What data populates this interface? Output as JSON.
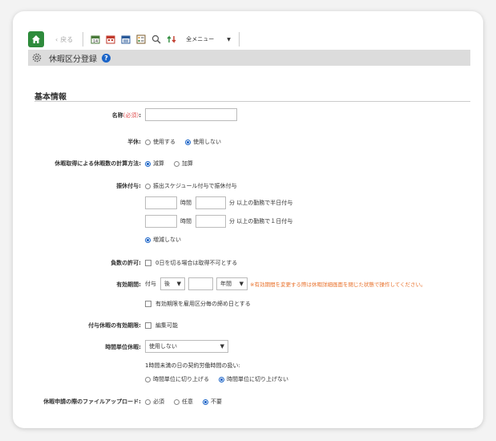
{
  "toolbar": {
    "back_label": "戻る",
    "menu_label": "全メニュー",
    "icons": [
      "calendar-14-icon",
      "calendar-red-icon",
      "calendar-list-icon",
      "card-list-icon",
      "magnify-icon",
      "sort-arrows-icon"
    ]
  },
  "title_bar": {
    "title": "休暇区分登録",
    "help": "?"
  },
  "section": {
    "title": "基本情報"
  },
  "form": {
    "name": {
      "label": "名称",
      "required": "(必須)",
      "colon": ":",
      "value": ""
    },
    "half": {
      "label": "半休:",
      "options": [
        "使用する",
        "使用しない"
      ],
      "selected": 1
    },
    "calc": {
      "label": "休暇取得による休暇数の計算方法:",
      "options": [
        "減算",
        "加算"
      ],
      "selected": 0
    },
    "grant": {
      "label": "振休付与:",
      "option_schedule": "振出スケジュール付与で振休付与",
      "hour_unit": "時間",
      "min_half": "分 以上の勤務で半日付与",
      "min_full": "分 以上の勤務で１日付与",
      "option_none": "増減しない",
      "selected": "none"
    },
    "negative": {
      "label": "負数の許可:",
      "text": "0日を切る場合は取得不可とする"
    },
    "validity": {
      "label": "有効期間:",
      "prefix": "付与",
      "after_value": "後",
      "unit_value": "年間",
      "warning": "※有効期間を変更する際は休暇詳細画面を閉じた状態で操作してください。",
      "closing_text": "有効期限を雇用区分毎の締め日とする"
    },
    "grant_validity": {
      "label": "付与休暇の有効期限:",
      "text": "編集可能"
    },
    "hourly": {
      "label": "時間単位休暇:",
      "value": "使用しない",
      "note": "1時間未満の日の契約労働時間の扱い:",
      "options": [
        "時間単位に切り上げる",
        "時間単位に切り上げない"
      ],
      "selected": 1
    },
    "upload": {
      "label": "休暇申請の際のファイルアップロード:",
      "options": [
        "必須",
        "任意",
        "不要"
      ],
      "selected": 2
    }
  }
}
